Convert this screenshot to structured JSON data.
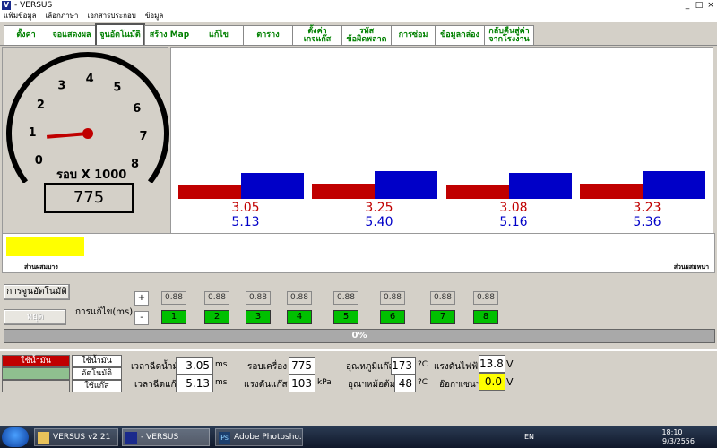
{
  "window": {
    "title": "- VERSUS",
    "logo": "V",
    "controls": [
      "_",
      "□",
      "×"
    ]
  },
  "menu": [
    "แฟ้มข้อมูล",
    "เลือกภาษา",
    "เอกสารประกอบ",
    "ข้อมูล"
  ],
  "tabs": [
    {
      "label": "ตั้งค่า",
      "w": 50
    },
    {
      "label": "จอแสดงผล",
      "w": 54
    },
    {
      "label": "จูนอัตโนมัติ",
      "w": 56,
      "active": true
    },
    {
      "label": "สร้าง Map",
      "w": 56
    },
    {
      "label": "แก้ไข",
      "w": 56
    },
    {
      "label": "ตาราง",
      "w": 56
    },
    {
      "label": "ตั้งค่า\nเกจแก๊ส",
      "w": 56
    },
    {
      "label": "รหัส\nข้อผิดพลาด",
      "w": 56
    },
    {
      "label": "การซ่อม",
      "w": 50
    },
    {
      "label": "ข้อมูลกล่อง",
      "w": 56
    },
    {
      "label": "กลับคืนสู่ค่า\nจากโรงงาน",
      "w": 56
    }
  ],
  "gauge": {
    "ticks": [
      "0",
      "1",
      "2",
      "3",
      "4",
      "5",
      "6",
      "7",
      "8"
    ],
    "label": "รอบ X 1000",
    "value": "775",
    "value_num": 0.775
  },
  "bars": [
    {
      "red": "3.05",
      "blue": "5.13"
    },
    {
      "red": "3.25",
      "blue": "5.40"
    },
    {
      "red": "3.08",
      "blue": "5.16"
    },
    {
      "red": "3.23",
      "blue": "5.36"
    }
  ],
  "strip": {
    "left": "ส่วนผสมบาง",
    "right": "ส่วนผสมหนา",
    "level": 0.11
  },
  "controls": {
    "autotune": "การจูนอัตโนมัติ",
    "stop": "หยุด",
    "correction_label": "การแก้ไข(ms)",
    "plus": "+",
    "minus": "-"
  },
  "injectors": [
    {
      "value": "0.88",
      "num": "1"
    },
    {
      "value": "0.88",
      "num": "2"
    },
    {
      "value": "0.88",
      "num": "3"
    },
    {
      "value": "0.88",
      "num": "4"
    },
    {
      "value": "0.88",
      "num": "5"
    },
    {
      "value": "0.88",
      "num": "6"
    },
    {
      "value": "0.88",
      "num": "7"
    },
    {
      "value": "0.88",
      "num": "8"
    }
  ],
  "progress": {
    "text": "0%",
    "value": 0
  },
  "status": {
    "fuel_state": "ใช้น้ำมัน",
    "btn_oil": "ใช้น้ำมัน",
    "btn_auto": "อัตโนมัติ",
    "btn_gas": "ใช้แก๊ส"
  },
  "readouts": {
    "fuel_time_label": "เวลาฉีดน้ำมัน",
    "fuel_time": "3.05",
    "fuel_time_unit": "ms",
    "gas_time_label": "เวลาฉีดแก๊ส",
    "gas_time": "5.13",
    "gas_time_unit": "ms",
    "rpm_label": "รอบเครื่อง",
    "rpm": "775",
    "pressure_label": "แรงดันแก๊ส",
    "pressure": "103",
    "pressure_unit": "kPa",
    "gas_temp_label": "อุณหภูมิแก๊ส",
    "gas_temp": "173",
    "gas_temp_unit": "?C",
    "reducer_temp_label": "อุณฯหม้อต้ม",
    "reducer_temp": "48",
    "reducer_temp_unit": "?C",
    "voltage_label": "แรงดันไฟฟ้า",
    "voltage": "13.8",
    "voltage_unit": "V",
    "o2_label": "อ๊อกฯเซนฯ",
    "o2": "0.0",
    "o2_unit": "V"
  },
  "colors": {
    "red": "#c00000",
    "blue": "#0000c8",
    "green": "#00c000",
    "yellow": "#ffff00",
    "tab_text": "#008000"
  },
  "taskbar": {
    "tasks": [
      "VERSUS v2.21",
      "- VERSUS",
      "Adobe Photosho..."
    ],
    "lang": "EN",
    "time": "18:10",
    "date": "9/3/2556"
  }
}
